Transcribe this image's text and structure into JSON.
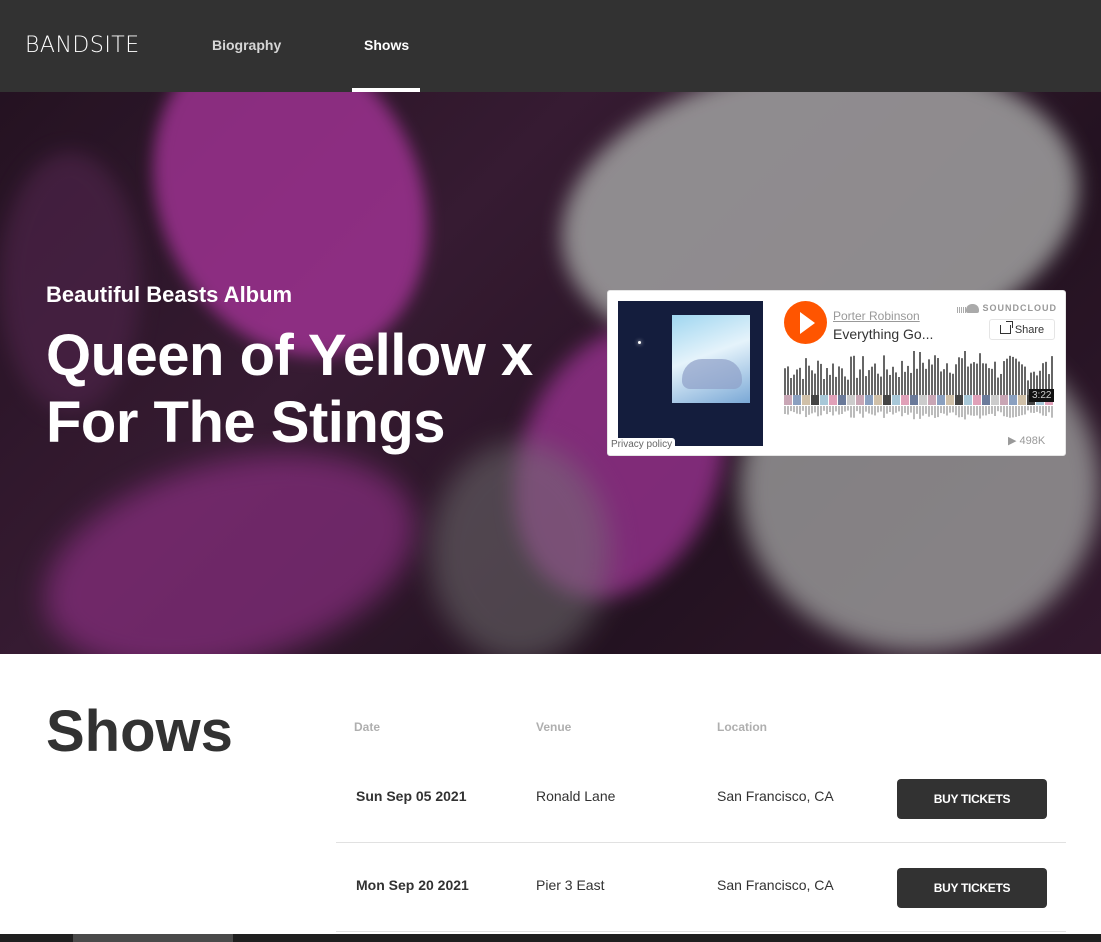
{
  "header": {
    "logo": "BANDSITE",
    "nav": [
      {
        "label": "Biography"
      },
      {
        "label": "Shows"
      }
    ]
  },
  "hero": {
    "album_label": "Beautiful Beasts Album",
    "title": "Queen of Yellow x For The Stings"
  },
  "player": {
    "artist": "Porter Robinson",
    "track": "Everything Go...",
    "brand": "SOUNDCLOUD",
    "share_label": "Share",
    "duration": "3:22",
    "plays": "498K",
    "privacy": "Privacy policy",
    "colors": {
      "accent": "#ff5500"
    }
  },
  "shows": {
    "heading": "Shows",
    "columns": [
      "Date",
      "Venue",
      "Location"
    ],
    "rows": [
      {
        "date": "Sun Sep 05 2021",
        "venue": "Ronald Lane",
        "location": "San Francisco, CA",
        "button": "BUY TICKETS"
      },
      {
        "date": "Mon Sep 20 2021",
        "venue": "Pier 3 East",
        "location": "San Francisco, CA",
        "button": "BUY TICKETS"
      }
    ]
  }
}
